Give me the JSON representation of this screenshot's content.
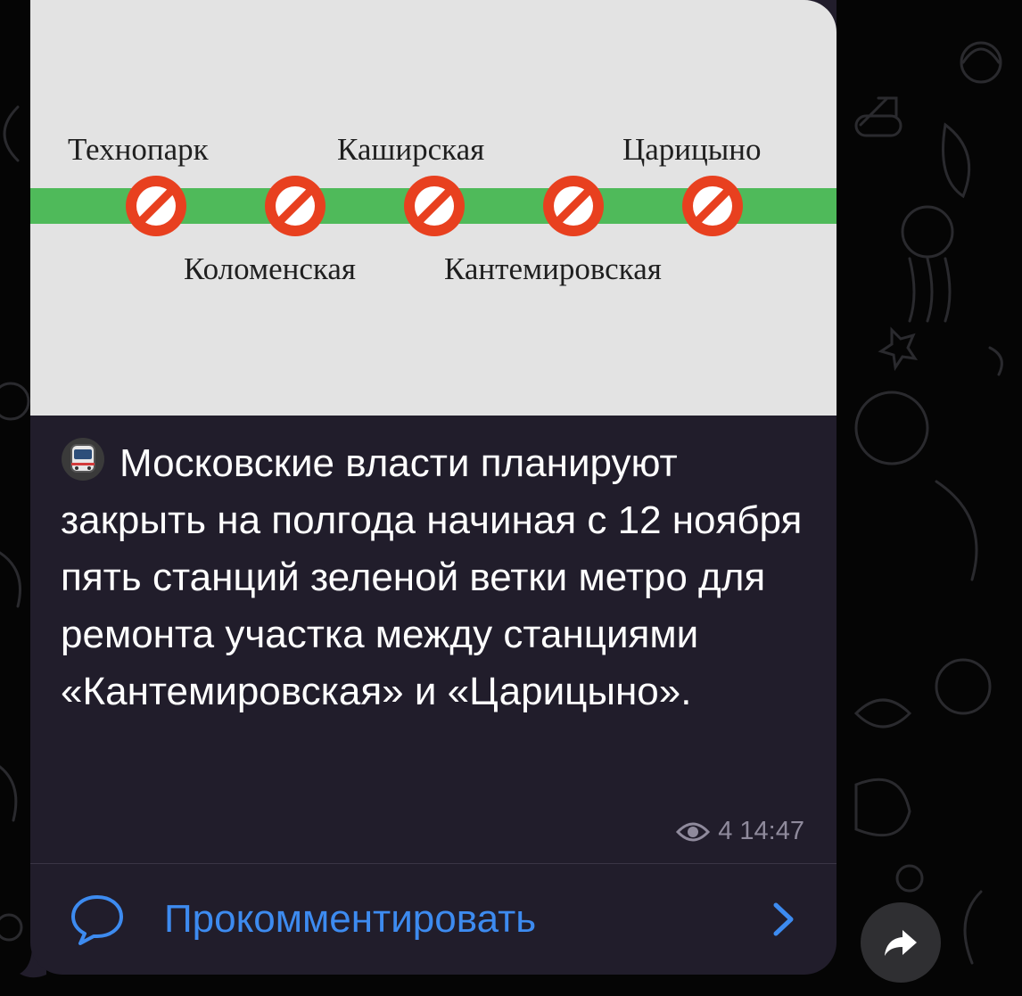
{
  "post": {
    "media": {
      "stations_top": [
        "Технопарк",
        "Каширская",
        "Царицыно"
      ],
      "stations_bottom": [
        "Коломенская",
        "Кантемировская"
      ],
      "line_color": "#4fba5a",
      "closed_marker_color": "#e8401f",
      "marker_icon": "no-entry-icon"
    },
    "emoji": "train-icon",
    "caption": "Московские власти планируют закрыть на полгода начиная с 12 ноября пять станций зеленой ветки метро для ремонта участка между станциями «Кантемировская» и «Царицыно».",
    "views": "4",
    "time": "14:47"
  },
  "comments": {
    "label": "Прокомментировать",
    "icon": "comment-bubble-icon",
    "chevron": "chevron-right-icon"
  },
  "share": {
    "icon": "share-arrow-icon"
  },
  "colors": {
    "accent": "#3d8bf0",
    "bubble": "#211d2b",
    "background": "#050505"
  }
}
